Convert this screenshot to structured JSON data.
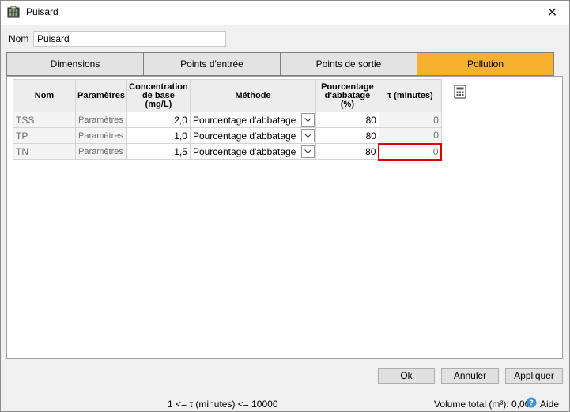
{
  "window": {
    "title": "Puisard",
    "close_glyph": "✕"
  },
  "name_field": {
    "label": "Nom",
    "value": "Puisard"
  },
  "tabs": [
    {
      "label": "Dimensions",
      "active": false
    },
    {
      "label": "Points d'entrée",
      "active": false
    },
    {
      "label": "Points de sortie",
      "active": false
    },
    {
      "label": "Pollution",
      "active": true
    }
  ],
  "table": {
    "headers": {
      "name": "Nom",
      "params": "Paramètres",
      "conc": "Concentration de base (mg/L)",
      "method": "Méthode",
      "pct": "Pourcentage d'abbatage (%)",
      "tau": "τ (minutes)"
    },
    "rows": [
      {
        "name": "TSS",
        "params": "Paramètres",
        "conc": "2,0",
        "method": "Pourcentage d'abbatage",
        "pct": "80",
        "tau": "0"
      },
      {
        "name": "TP",
        "params": "Paramètres",
        "conc": "1,0",
        "method": "Pourcentage d'abbatage",
        "pct": "80",
        "tau": "0"
      },
      {
        "name": "TN",
        "params": "Paramètres",
        "conc": "1,5",
        "method": "Pourcentage d'abbatage",
        "pct": "80",
        "tau": "0"
      }
    ]
  },
  "buttons": {
    "ok": "Ok",
    "cancel": "Annuler",
    "apply": "Appliquer"
  },
  "status": {
    "rule": "1 <= τ (minutes) <= 10000",
    "total_volume": "Volume total (m³): 0,000",
    "help": "Aide"
  },
  "colors": {
    "active_tab": "#f6b22f",
    "error_border": "#e00000",
    "help_icon": "#3a8fd6"
  },
  "icons": [
    "app-icon",
    "close-icon",
    "chevron-down-icon",
    "calculator-icon",
    "help-icon"
  ]
}
